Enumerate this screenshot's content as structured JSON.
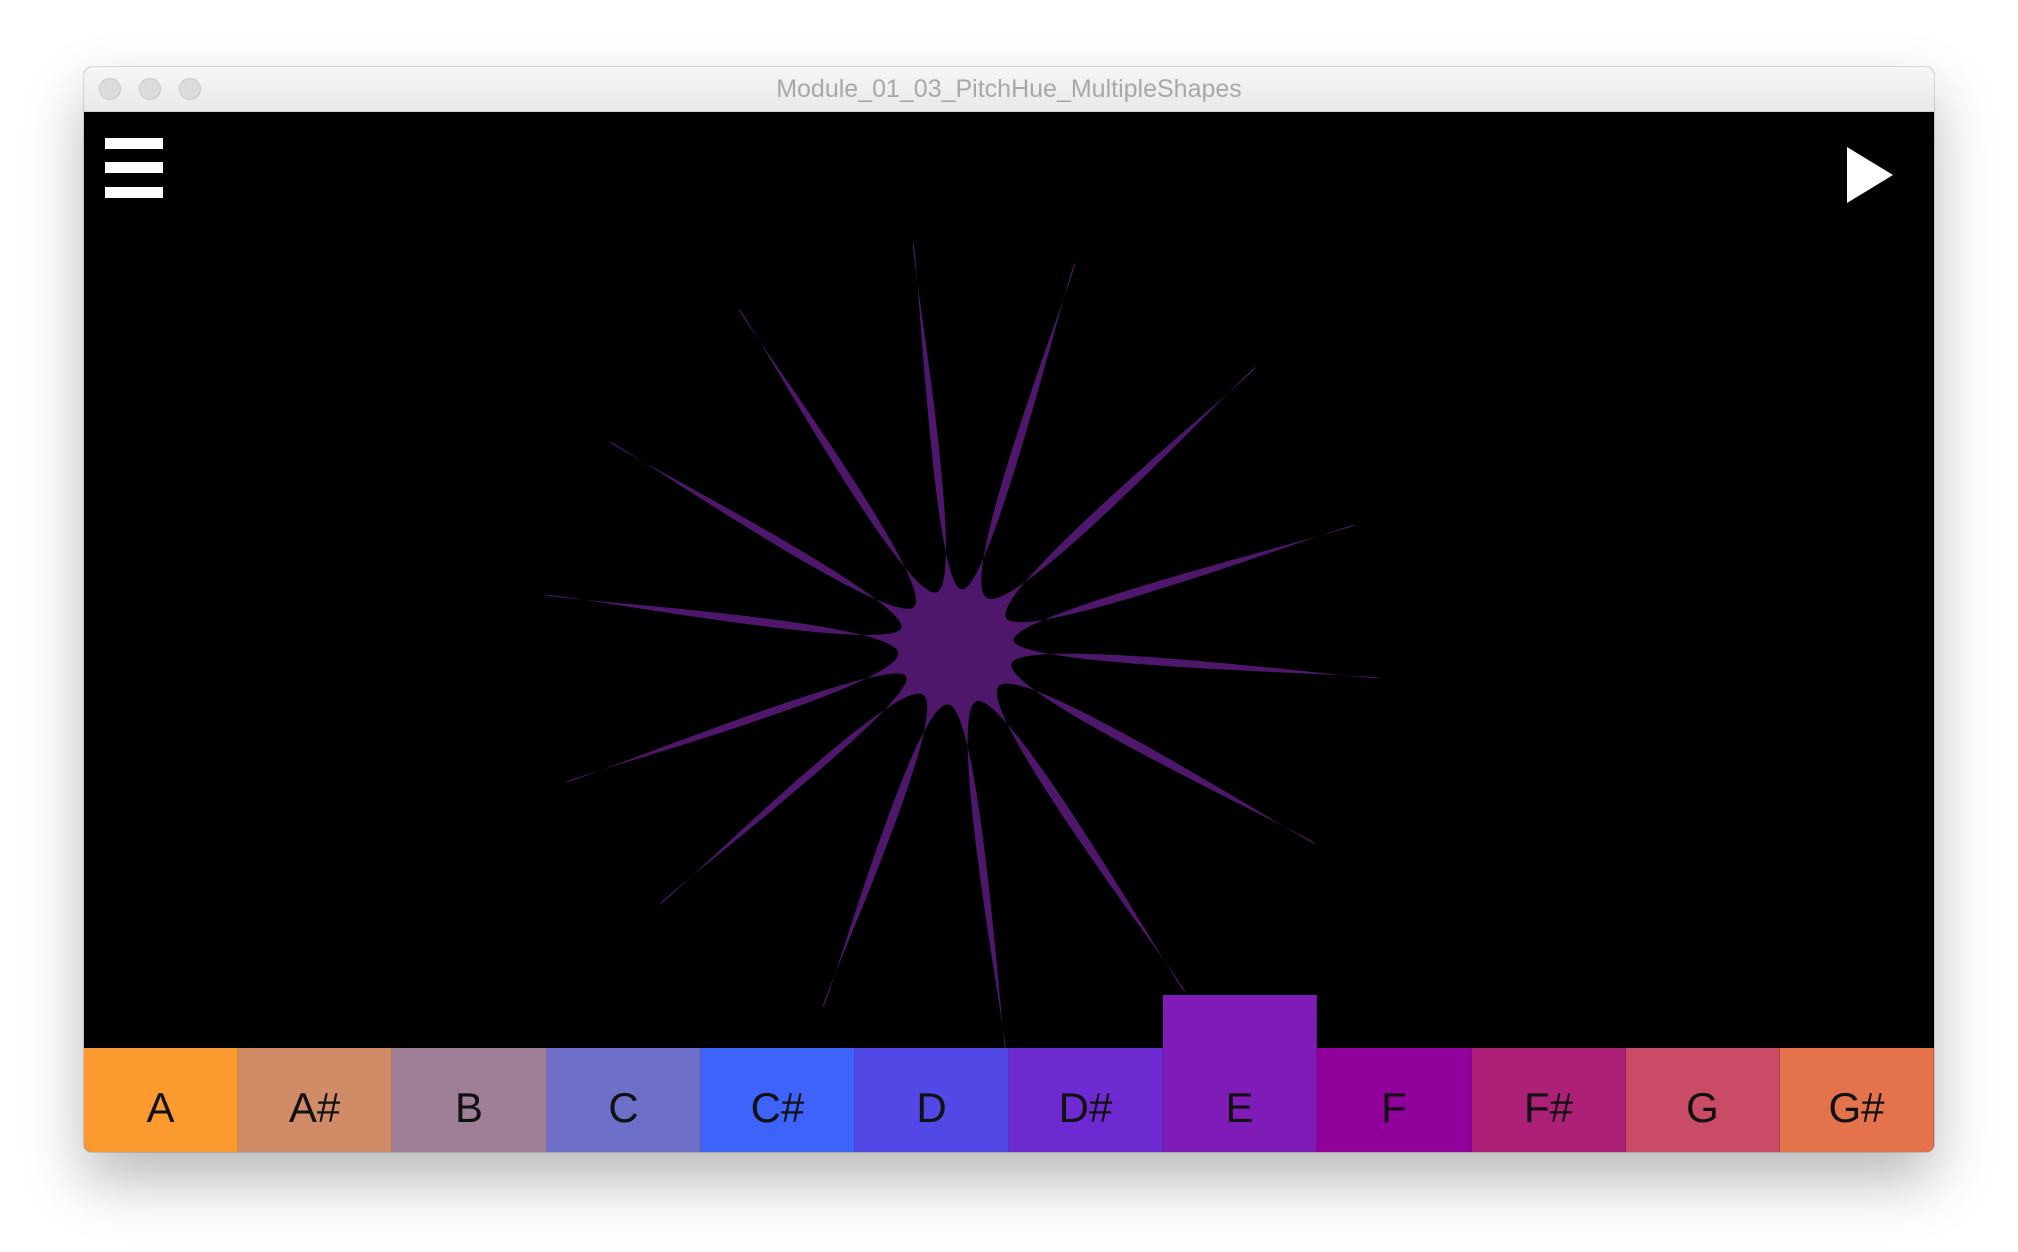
{
  "window": {
    "title": "Module_01_03_PitchHue_MultipleShapes"
  },
  "toolbar": {
    "menu_icon": "hamburger-menu-icon",
    "play_icon": "play-icon"
  },
  "shape": {
    "type": "star",
    "color": "#4e176b",
    "points": 12
  },
  "colors": {
    "canvas_background": "#000000",
    "icon": "#ffffff"
  },
  "keys": [
    {
      "label": "A",
      "color": "#fd9a2f",
      "active": false
    },
    {
      "label": "A#",
      "color": "#d08c66",
      "active": false
    },
    {
      "label": "B",
      "color": "#9f7f98",
      "active": false
    },
    {
      "label": "C",
      "color": "#6d6fc9",
      "active": false
    },
    {
      "label": "C#",
      "color": "#3d63fb",
      "active": false
    },
    {
      "label": "D",
      "color": "#5248e5",
      "active": false
    },
    {
      "label": "D#",
      "color": "#6c2ad0",
      "active": false
    },
    {
      "label": "E",
      "color": "#7f1bb6",
      "active": true
    },
    {
      "label": "F",
      "color": "#92009b",
      "active": false
    },
    {
      "label": "F#",
      "color": "#ad2078",
      "active": false
    },
    {
      "label": "G",
      "color": "#c94b65",
      "active": false
    },
    {
      "label": "G#",
      "color": "#e4724b",
      "active": false
    }
  ]
}
